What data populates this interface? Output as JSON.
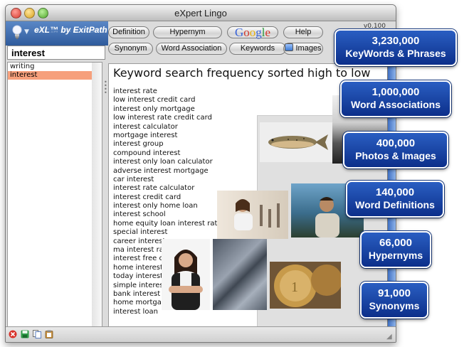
{
  "window": {
    "title": "eXpert Lingo",
    "version": "v0.100"
  },
  "brand": {
    "logo_text": "eXL™ by ExitPath"
  },
  "search": {
    "value": "interest"
  },
  "word_list": [
    "writing",
    "interest"
  ],
  "toolbar": {
    "definition": "Definition",
    "hypernym": "Hypernym",
    "google_letters": [
      "G",
      "o",
      "o",
      "g",
      "l",
      "e"
    ],
    "help": "Help",
    "synonym": "Synonym",
    "word_association": "Word Association",
    "keywords": "Keywords",
    "images": "Images"
  },
  "results": {
    "heading": "Keyword search frequency sorted high to low",
    "items": [
      "interest rate",
      "low interest credit card",
      "interest only mortgage",
      "low interest rate credit card",
      "interest calculator",
      "mortgage interest",
      "interest group",
      "compound interest",
      "interest only loan calculator",
      "adverse interest mortgage",
      "car interest",
      "interest rate calculator",
      "interest credit card",
      "interest only home loan",
      "interest school",
      "home equity loan interest rate",
      "special interest",
      "career interest",
      "ma interest ra",
      "interest free c",
      "home interest",
      "today interest",
      "simple interes",
      "bank interest",
      "home mortgag",
      "interest loan"
    ]
  },
  "stats": [
    {
      "number": "3,230,000",
      "label": "KeyWords & Phrases"
    },
    {
      "number": "1,000,000",
      "label": "Word Associations"
    },
    {
      "number": "400,000",
      "label": "Photos & Images"
    },
    {
      "number": "140,000",
      "label": "Word Definitions"
    },
    {
      "number": "66,000",
      "label": "Hypernyms"
    },
    {
      "number": "91,000",
      "label": "Synonyms"
    }
  ],
  "colors": {
    "stat_badge": "#1a45a8",
    "selection": "#f6a07c",
    "brand_bar": "#3f6db0",
    "scrollbar": "#5a88d6"
  },
  "icons": {
    "close": "close-circle-icon",
    "save": "save-icon",
    "copy": "copy-icon",
    "paste": "paste-icon",
    "lightbulb": "lightbulb-icon"
  }
}
